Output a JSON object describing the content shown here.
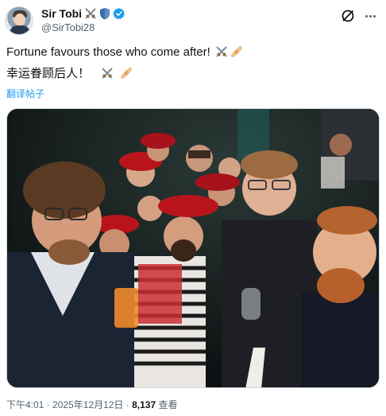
{
  "author": {
    "display_name": "Sir Tobi",
    "handle": "@SirTobi28",
    "badges": [
      "crossed-swords-icon",
      "shield-icon",
      "verified-badge-icon"
    ],
    "verified_color": "#1d9bf0"
  },
  "actions": {
    "grok_icon": "grok-icon",
    "more_icon": "more-icon"
  },
  "tweet": {
    "text_en": "Fortune favours those who come after!",
    "text_zh": "幸运眷顾后人！",
    "text_emojis": [
      "crossed-swords-icon",
      "bandage-icon"
    ],
    "translate_label": "翻译帖子"
  },
  "media": {
    "alt": "",
    "type": "photo"
  },
  "meta": {
    "time": "下午4:01",
    "separator": " · ",
    "date": "2025年12月12日",
    "views_count": "8,137",
    "views_label": "查看"
  },
  "colors": {
    "link": "#1d9bf0",
    "secondary_text": "#536471",
    "primary_text": "#0f1419",
    "border": "#cfd9de"
  }
}
